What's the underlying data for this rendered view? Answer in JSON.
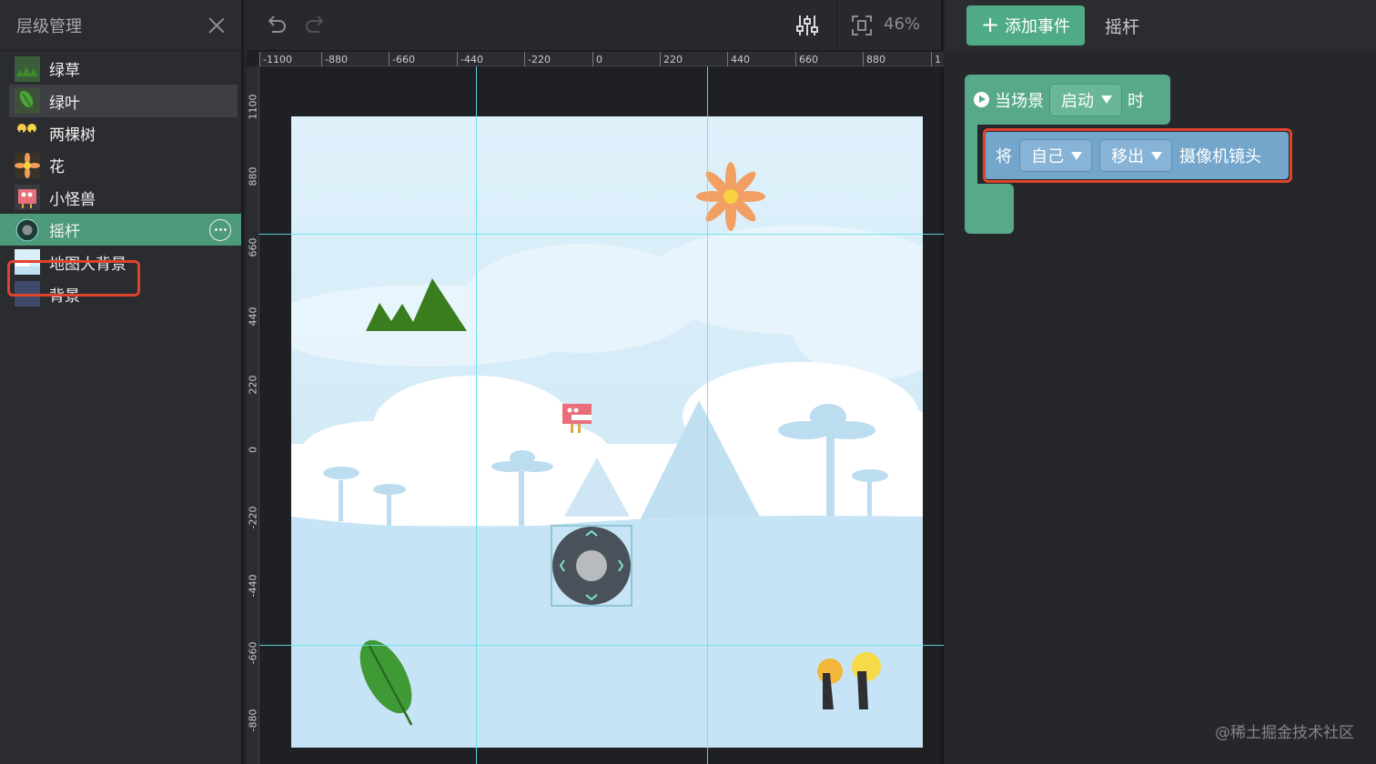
{
  "layer_panel": {
    "title": "层级管理",
    "layers": [
      {
        "label": "绿草",
        "icon": "grass-icon"
      },
      {
        "label": "绿叶",
        "icon": "leaf-icon"
      },
      {
        "label": "两棵树",
        "icon": "trees-icon"
      },
      {
        "label": "花",
        "icon": "flower-icon"
      },
      {
        "label": "小怪兽",
        "icon": "monster-icon"
      },
      {
        "label": "摇杆",
        "icon": "joystick-icon"
      },
      {
        "label": "地图大背景",
        "icon": "map-background-icon"
      },
      {
        "label": "背景",
        "icon": "background-icon"
      }
    ],
    "hover_index": 1,
    "selected_index": 5
  },
  "toolbar": {
    "zoom": "46%"
  },
  "rulers": {
    "top_labels": [
      "-1100",
      "-880",
      "-660",
      "-440",
      "-220",
      "0",
      "220",
      "440",
      "660",
      "880",
      "1"
    ],
    "left_labels": [
      "1100",
      "880",
      "660",
      "440",
      "220",
      "0",
      "-220",
      "-440",
      "-660",
      "-880"
    ]
  },
  "event_panel": {
    "add_event_label": "添加事件",
    "target_label": "摇杆",
    "hat_block": {
      "prefix": "当场景",
      "dropdown": "启动",
      "suffix": "时"
    },
    "command_block": {
      "prefix": "将",
      "subject": "自己",
      "action": "移出",
      "suffix": "摄像机镜头"
    }
  },
  "watermark": "@稀土掘金技术社区",
  "colors": {
    "selected": "#4d9a7a",
    "event_green": "#57a98a",
    "command_blue": "#74a6cc",
    "highlight_red": "#e0432c",
    "guide_cyan": "#5fe3e8"
  }
}
